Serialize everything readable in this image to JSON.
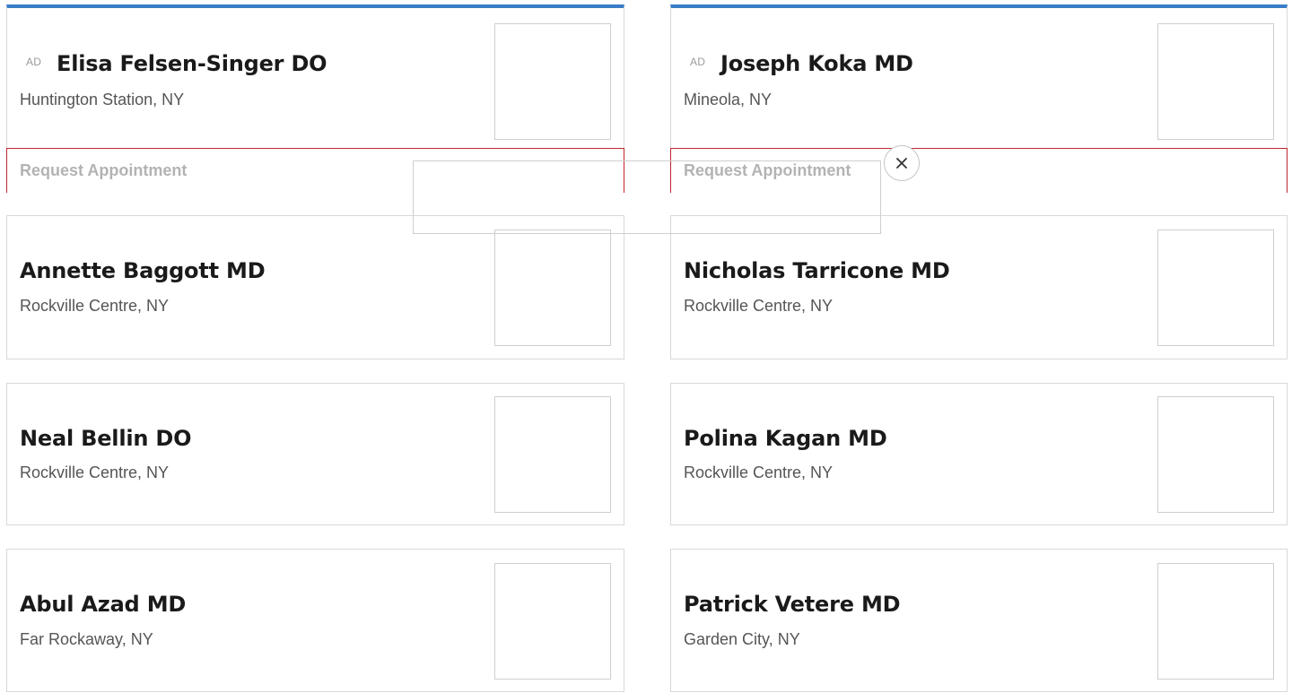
{
  "featured": [
    {
      "ad_tag": "AD",
      "name": "Elisa Felsen-Singer DO",
      "location": "Huntington Station, NY",
      "request_label": "Request Appointment"
    },
    {
      "ad_tag": "AD",
      "name": "Joseph Koka MD",
      "location": "Mineola, NY",
      "request_label": "Request Appointment"
    }
  ],
  "doctors": [
    {
      "name": "Annette Baggott MD",
      "location": "Rockville Centre, NY"
    },
    {
      "name": "Nicholas Tarricone MD",
      "location": "Rockville Centre, NY"
    },
    {
      "name": "Neal Bellin DO",
      "location": "Rockville Centre, NY"
    },
    {
      "name": "Polina Kagan MD",
      "location": "Rockville Centre, NY"
    },
    {
      "name": "Abul Azad MD",
      "location": "Far Rockaway, NY"
    },
    {
      "name": "Patrick Vetere MD",
      "location": "Garden City, NY"
    }
  ],
  "overlay": {
    "close_icon": "close-icon"
  },
  "colors": {
    "accent": "#3a7cc7",
    "request_border": "#c0262d",
    "card_border": "#d9d9d9"
  }
}
